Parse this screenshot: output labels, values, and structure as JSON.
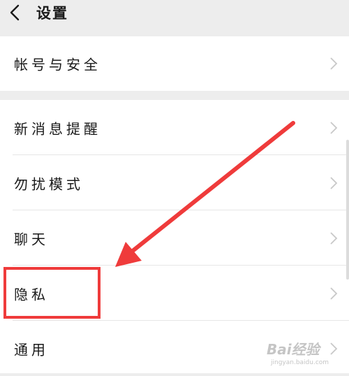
{
  "header": {
    "title": "设置",
    "back_icon": "chevron-left-icon"
  },
  "groups": [
    {
      "items": [
        {
          "label": "帐号与安全"
        }
      ]
    },
    {
      "items": [
        {
          "label": "新消息提醒"
        },
        {
          "label": "勿扰模式"
        },
        {
          "label": "聊天"
        },
        {
          "label": "隐私"
        },
        {
          "label": "通用"
        }
      ]
    }
  ],
  "annotation": {
    "highlight_color": "#ef3b3b",
    "highlighted_item": "隐私"
  },
  "watermark": {
    "brand": "Bai经验",
    "url": "jingyan.baidu.com"
  },
  "colors": {
    "background": "#ededed",
    "card": "#ffffff",
    "text": "#1a1a1a",
    "divider": "#e6e6e6",
    "chevron": "#c8c8c8"
  }
}
